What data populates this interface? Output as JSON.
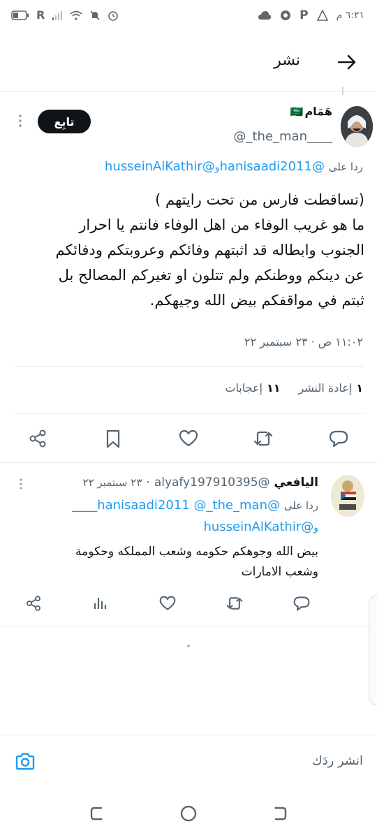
{
  "status_bar": {
    "time": "٦:٢١ م",
    "carrier_letter": "R"
  },
  "header": {
    "title": "نشر"
  },
  "tweet": {
    "display_name": "هَمَام",
    "flag_emoji": "🇸🇦",
    "handle": "@_the_man____",
    "follow_label": "تابِع",
    "reply_to_prefix": "ردا على",
    "reply_to_link1": "@hanisaadi2011",
    "reply_to_and": "و",
    "reply_to_link2": "@husseinAlKathir",
    "text_lines": [
      "(تساقطت فارس من تحت رايتهم )",
      "ما هو غريب الوفاء من اهل الوفاء فانتم يا احرار",
      "الجنوب وابطاله قد اثبتهم وفائكم وعروبتكم ودفائكم",
      "عن دينكم  ووطنكم ولم تتلون او تغيركم المصالح بل",
      "ثبتم في مواقفكم بيض الله وجيهكم."
    ],
    "timestamp": "١١:٠٢ ص · ٢٣ سبتمبر ٢٢",
    "retweets_count": "١",
    "retweets_label": "إعادة النشر",
    "likes_count": "١١",
    "likes_label": "إعجابات"
  },
  "reply": {
    "display_name": "اليافعي",
    "handle": "@alyafy197910395",
    "date": "٢٣ سبتمبر ٢٢",
    "dot": "·",
    "reply_to_prefix": "ردا على",
    "reply_to_link1": "@hanisaadi2011",
    "reply_to_link2": "@_the_man____",
    "reply_to_and": "و",
    "reply_to_link3": "@husseinAlKathir",
    "text_lines": [
      "بيض الله وجوهكم حكومه وشعب المملكه وحكومة",
      "وشعب الامارات"
    ]
  },
  "composer": {
    "placeholder": "انشر ردَك"
  },
  "icons": {
    "back": "arrow-right-icon",
    "more": "more-vertical-icon",
    "reply": "comment-icon",
    "retweet": "retweet-icon",
    "like": "heart-icon",
    "bookmark": "bookmark-icon",
    "share": "share-icon",
    "views": "analytics-icon",
    "camera": "camera-icon"
  },
  "colors": {
    "accent": "#1d9bf0",
    "text": "#0f1419",
    "muted": "#536471",
    "follow_bg": "#0f1419"
  }
}
